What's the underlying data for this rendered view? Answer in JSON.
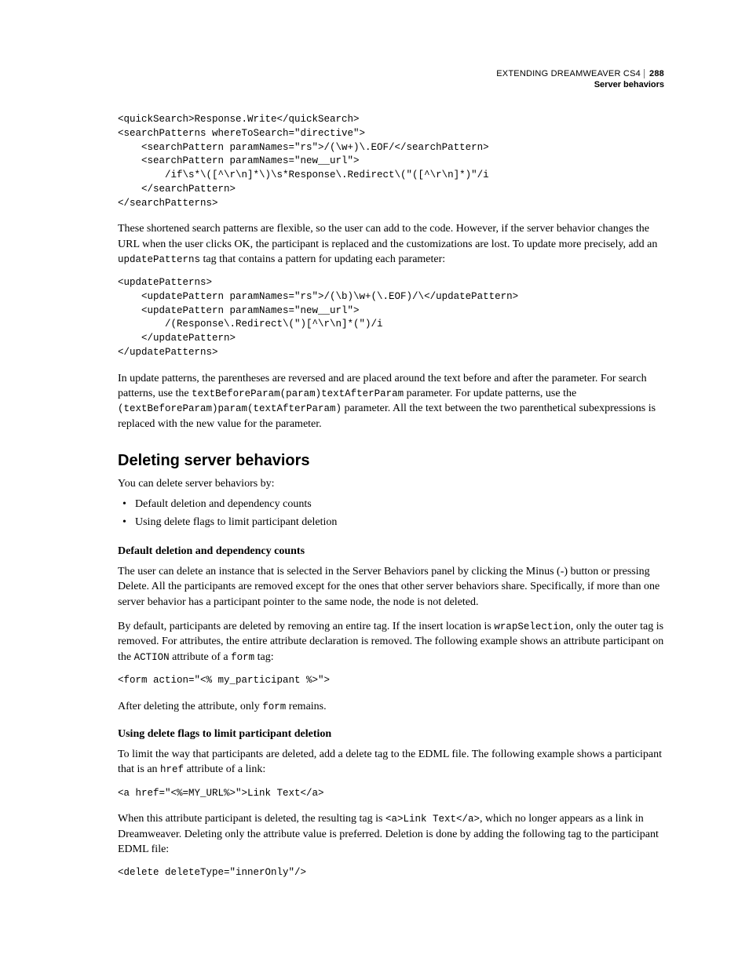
{
  "header": {
    "title": "EXTENDING DREAMWEAVER CS4",
    "section": "Server behaviors",
    "page_number": "288"
  },
  "code1": "<quickSearch>Response.Write</quickSearch>\n<searchPatterns whereToSearch=\"directive\">\n    <searchPattern paramNames=\"rs\">/(\\w+)\\.EOF/</searchPattern>\n    <searchPattern paramNames=\"new__url\">\n        /if\\s*\\([^\\r\\n]*\\)\\s*Response\\.Redirect\\(\"([^\\r\\n]*)\"/i\n    </searchPattern>\n</searchPatterns>",
  "para1_a": "These shortened search patterns are flexible, so the user can add to the code. However, if the server behavior changes the URL when the user clicks OK, the participant is replaced and the customizations are lost. To update more precisely, add an ",
  "para1_code": "updatePatterns",
  "para1_b": " tag that contains a pattern for updating each parameter:",
  "code2": "<updatePatterns>\n    <updatePattern paramNames=\"rs\">/(\\b)\\w+(\\.EOF)/\\</updatePattern>\n    <updatePattern paramNames=\"new__url\">\n        /(Response\\.Redirect\\(\")[^\\r\\n]*(\")/i\n    </updatePattern>\n</updatePatterns>",
  "para2_a": "In update patterns, the parentheses are reversed and are placed around the text before and after the parameter. For search patterns, use the ",
  "para2_code1": "textBeforeParam(param)textAfterParam",
  "para2_b": " parameter. For update patterns, use the ",
  "para2_code2": "(textBeforeParam)param(textAfterParam)",
  "para2_c": " parameter. All the text between the two parenthetical subexpressions is replaced with the new value for the parameter.",
  "section_heading": "Deleting server behaviors",
  "para3": "You can delete server behaviors by:",
  "bullets": {
    "b1": "Default deletion and dependency counts",
    "b2": "Using delete flags to limit participant deletion"
  },
  "subhead1": "Default deletion and dependency counts",
  "para4": "The user can delete an instance that is selected in the Server Behaviors panel by clicking the Minus (-) button or pressing Delete. All the participants are removed except for the ones that other server behaviors share. Specifically, if more than one server behavior has a participant pointer to the same node, the node is not deleted.",
  "para5_a": "By default, participants are deleted by removing an entire tag. If the insert location is ",
  "para5_code1": "wrapSelection",
  "para5_b": ", only the outer tag is removed. For attributes, the entire attribute declaration is removed. The following example shows an attribute participant on the ",
  "para5_code2": "ACTION",
  "para5_c": " attribute of a ",
  "para5_code3": "form",
  "para5_d": " tag:",
  "code3": "<form action=\"<% my_participant %>\">",
  "para6_a": "After deleting the attribute, only ",
  "para6_code": "form",
  "para6_b": " remains.",
  "subhead2": "Using delete flags to limit participant deletion",
  "para7_a": "To limit the way that participants are deleted, add a delete tag to the EDML file. The following example shows a participant that is an ",
  "para7_code": "href",
  "para7_b": " attribute of a link:",
  "code4": "<a href=\"<%=MY_URL%>\">Link Text</a>",
  "para8_a": "When this attribute participant is deleted, the resulting tag is ",
  "para8_code": "<a>Link Text</a>",
  "para8_b": ", which no longer appears as a link in Dreamweaver. Deleting only the attribute value is preferred. Deletion is done by adding the following tag to the participant EDML file:",
  "code5": "<delete deleteType=\"innerOnly\"/>"
}
